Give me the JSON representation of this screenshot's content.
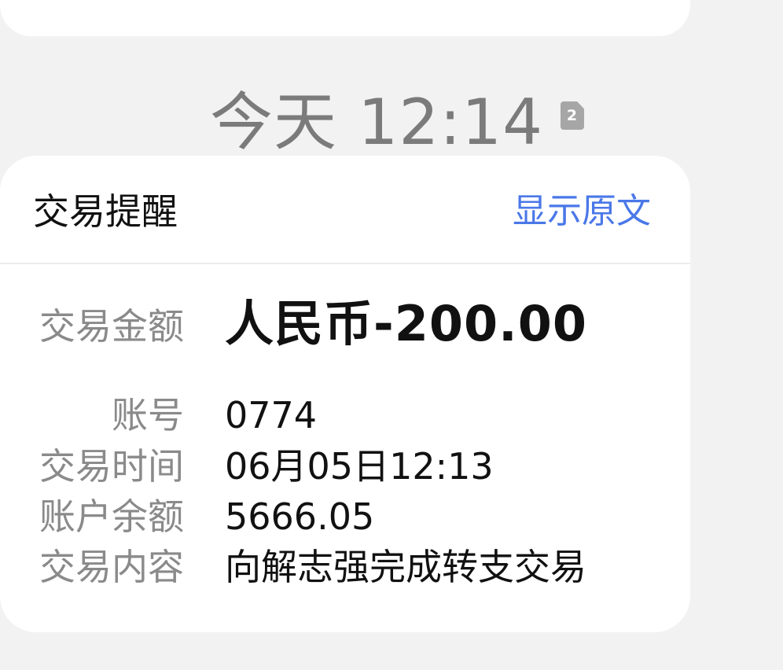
{
  "timestamp": {
    "text": "今天 12:14",
    "sim_badge": "2"
  },
  "card": {
    "title": "交易提醒",
    "show_original": "显示原文",
    "amount": {
      "label": "交易金额",
      "value": "人民币-200.00"
    },
    "fields": [
      {
        "label": "账号",
        "value": "0774"
      },
      {
        "label": "交易时间",
        "value": "06月05日12:13"
      },
      {
        "label": "账户余额",
        "value": "5666.05"
      },
      {
        "label": "交易内容",
        "value": "向解志强完成转支交易"
      }
    ]
  },
  "colors": {
    "background": "#f2f2f2",
    "card": "#ffffff",
    "link": "#4a78e8",
    "label": "#8a8a8a",
    "value": "#111111",
    "timestamp": "#7b7b7b"
  }
}
